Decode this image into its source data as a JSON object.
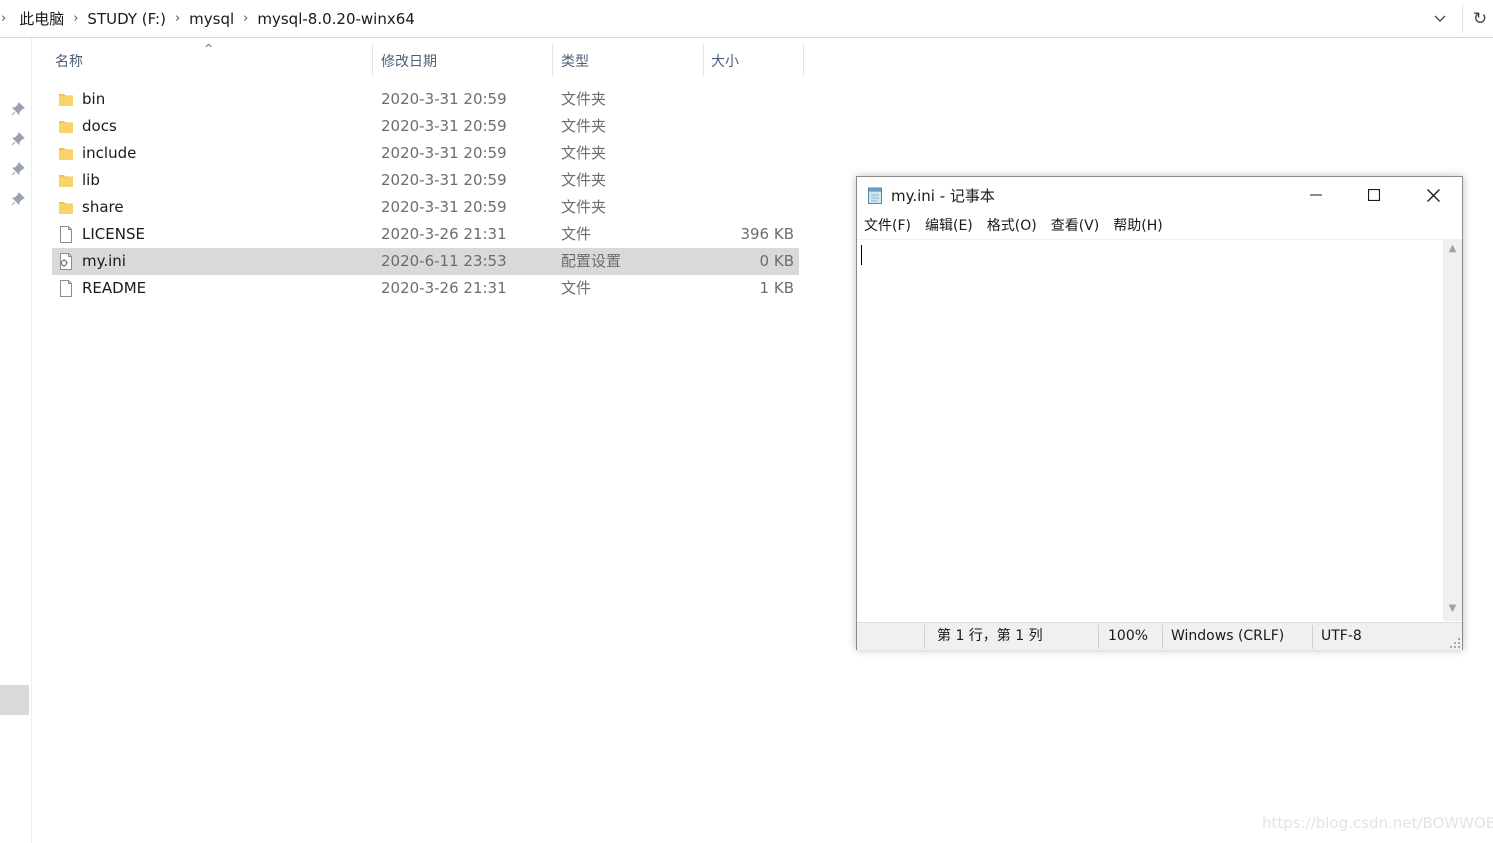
{
  "address_bar": {
    "crumbs": [
      "此电脑",
      "STUDY (F:)",
      "mysql",
      "mysql-8.0.20-winx64"
    ]
  },
  "columns": {
    "name": "名称",
    "date": "修改日期",
    "type": "类型",
    "size": "大小"
  },
  "files": [
    {
      "name": "bin",
      "date": "2020-3-31 20:59",
      "type": "文件夹",
      "size": "",
      "icon": "folder-icon"
    },
    {
      "name": "docs",
      "date": "2020-3-31 20:59",
      "type": "文件夹",
      "size": "",
      "icon": "folder-icon"
    },
    {
      "name": "include",
      "date": "2020-3-31 20:59",
      "type": "文件夹",
      "size": "",
      "icon": "folder-icon"
    },
    {
      "name": "lib",
      "date": "2020-3-31 20:59",
      "type": "文件夹",
      "size": "",
      "icon": "folder-icon"
    },
    {
      "name": "share",
      "date": "2020-3-31 20:59",
      "type": "文件夹",
      "size": "",
      "icon": "folder-icon"
    },
    {
      "name": "LICENSE",
      "date": "2020-3-26 21:31",
      "type": "文件",
      "size": "396 KB",
      "icon": "file-icon"
    },
    {
      "name": "my.ini",
      "date": "2020-6-11 23:53",
      "type": "配置设置",
      "size": "0 KB",
      "icon": "config-file-icon",
      "selected": true
    },
    {
      "name": "README",
      "date": "2020-3-26 21:31",
      "type": "文件",
      "size": "1 KB",
      "icon": "file-icon"
    }
  ],
  "notepad": {
    "title": "my.ini - 记事本",
    "menu": [
      "文件(F)",
      "编辑(E)",
      "格式(O)",
      "查看(V)",
      "帮助(H)"
    ],
    "content": "",
    "status": {
      "position": "第 1 行，第 1 列",
      "zoom": "100%",
      "line_ending": "Windows (CRLF)",
      "encoding": "UTF-8"
    }
  },
  "watermark": "https://blog.csdn.net/BOWWOB",
  "colors": {
    "selection": "#d9d9d9",
    "folder": "#f5c146",
    "header_text": "#4c607a"
  }
}
